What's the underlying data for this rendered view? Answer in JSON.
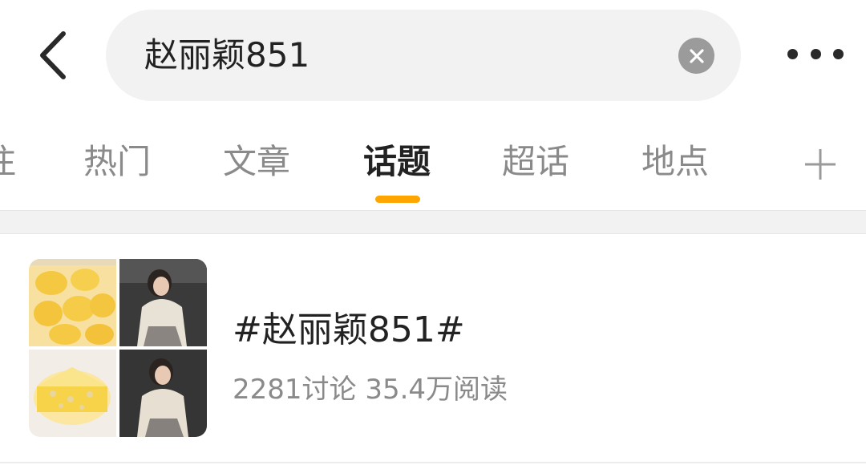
{
  "search": {
    "query": "赵丽颖851"
  },
  "icons": {
    "back": "chevron-left-icon",
    "clear": "clear-x-icon",
    "more": "more-dots-icon",
    "add": "plus-icon"
  },
  "tabs": [
    {
      "label": "注",
      "active": false
    },
    {
      "label": "热门",
      "active": false
    },
    {
      "label": "文章",
      "active": false
    },
    {
      "label": "话题",
      "active": true
    },
    {
      "label": "超话",
      "active": false
    },
    {
      "label": "地点",
      "active": false
    }
  ],
  "colors": {
    "accent": "#ffa500",
    "text_primary": "#222222",
    "text_secondary": "#8a8a8a",
    "search_bg": "#f2f2f2"
  },
  "result": {
    "title": "#赵丽颖851#",
    "stats": "2281讨论 35.4万阅读"
  }
}
